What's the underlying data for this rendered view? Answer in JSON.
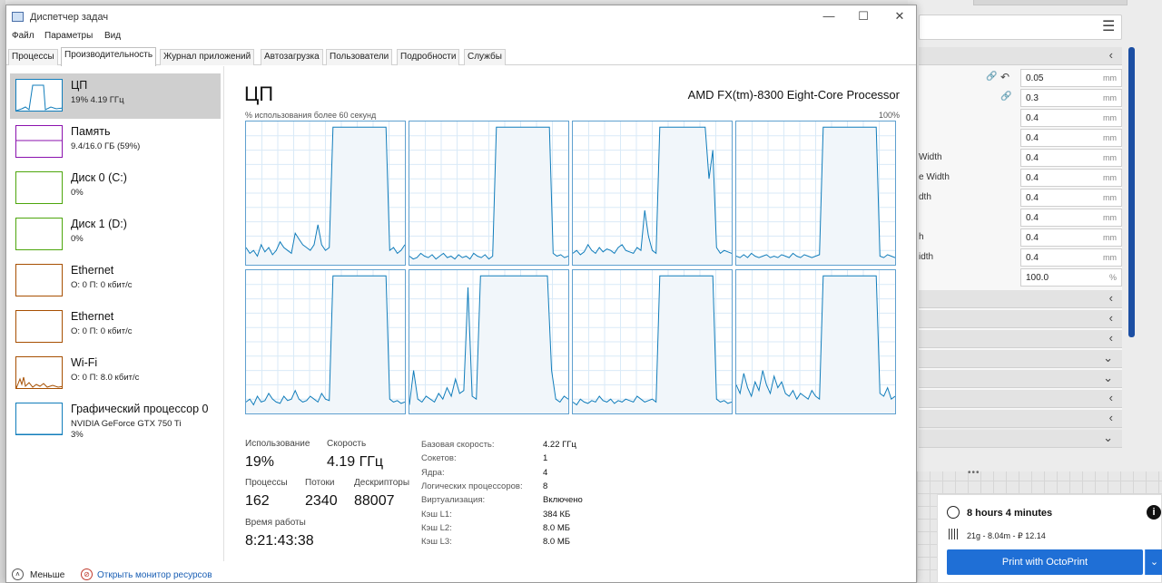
{
  "window": {
    "title": "Диспетчер задач",
    "minimize": "—",
    "maximize": "☐",
    "close": "✕"
  },
  "menu": [
    "Файл",
    "Параметры",
    "Вид"
  ],
  "tabs": [
    "Процессы",
    "Производительность",
    "Журнал приложений",
    "Автозагрузка",
    "Пользователи",
    "Подробности",
    "Службы"
  ],
  "active_tab": "Производительность",
  "resources": [
    {
      "name": "ЦП",
      "sub": "19% 4.19 ГГц",
      "color": "#117dbb"
    },
    {
      "name": "Память",
      "sub": "9.4/16.0 ГБ (59%)",
      "color": "#8b12ae"
    },
    {
      "name": "Диск 0 (C:)",
      "sub": "0%",
      "color": "#4da60c"
    },
    {
      "name": "Диск 1 (D:)",
      "sub": "0%",
      "color": "#4da60c"
    },
    {
      "name": "Ethernet",
      "sub": "О: 0 П: 0 кбит/с",
      "color": "#a74f01"
    },
    {
      "name": "Ethernet",
      "sub": "О: 0 П: 0 кбит/с",
      "color": "#a74f01"
    },
    {
      "name": "Wi-Fi",
      "sub": "О: 0 П: 8.0 кбит/с",
      "color": "#a74f01"
    },
    {
      "name": "Графический процессор 0",
      "sub": "NVIDIA GeForce GTX 750 Ti",
      "sub2": "3%",
      "color": "#117dbb"
    }
  ],
  "cpu": {
    "title": "ЦП",
    "model": "AMD FX(tm)-8300 Eight-Core Processor",
    "usage_label": "% использования более 60 секунд",
    "max_pct": "100%",
    "cores": [
      [
        12,
        8,
        10,
        6,
        14,
        9,
        12,
        7,
        10,
        16,
        12,
        10,
        8,
        22,
        18,
        14,
        12,
        10,
        14,
        28,
        14,
        10,
        12,
        96,
        96,
        96,
        96,
        96,
        96,
        96,
        96,
        96,
        96,
        96,
        96,
        96,
        96,
        96,
        10,
        12,
        8,
        10,
        14
      ],
      [
        6,
        4,
        5,
        8,
        6,
        5,
        7,
        4,
        6,
        8,
        5,
        6,
        4,
        7,
        5,
        6,
        4,
        8,
        6,
        5,
        7,
        4,
        6,
        96,
        96,
        96,
        96,
        96,
        96,
        96,
        96,
        96,
        96,
        96,
        96,
        96,
        96,
        96,
        8,
        6,
        7,
        5,
        6
      ],
      [
        8,
        10,
        7,
        9,
        14,
        10,
        8,
        12,
        9,
        11,
        10,
        8,
        12,
        14,
        10,
        9,
        8,
        12,
        10,
        38,
        20,
        10,
        8,
        96,
        96,
        96,
        96,
        96,
        96,
        96,
        96,
        96,
        96,
        96,
        96,
        96,
        60,
        80,
        12,
        8,
        10,
        9,
        8
      ],
      [
        6,
        5,
        7,
        5,
        8,
        6,
        5,
        6,
        7,
        5,
        6,
        5,
        7,
        6,
        5,
        8,
        6,
        5,
        7,
        6,
        5,
        6,
        7,
        96,
        96,
        96,
        96,
        96,
        96,
        96,
        96,
        96,
        96,
        96,
        96,
        96,
        96,
        96,
        6,
        5,
        7,
        6,
        5
      ],
      [
        8,
        10,
        6,
        12,
        8,
        9,
        14,
        10,
        8,
        7,
        12,
        9,
        10,
        16,
        10,
        8,
        9,
        12,
        10,
        8,
        14,
        10,
        9,
        96,
        96,
        96,
        96,
        96,
        96,
        96,
        96,
        96,
        96,
        96,
        96,
        96,
        96,
        96,
        10,
        8,
        9,
        7,
        8
      ],
      [
        6,
        30,
        10,
        8,
        12,
        10,
        8,
        14,
        10,
        18,
        12,
        24,
        14,
        16,
        88,
        12,
        10,
        96,
        96,
        96,
        96,
        96,
        96,
        96,
        96,
        96,
        96,
        96,
        96,
        96,
        96,
        96,
        96,
        96,
        30,
        10,
        8,
        12,
        10
      ],
      [
        8,
        6,
        10,
        8,
        7,
        9,
        8,
        12,
        9,
        8,
        10,
        7,
        9,
        8,
        10,
        9,
        8,
        12,
        10,
        8,
        9,
        10,
        8,
        96,
        96,
        96,
        96,
        96,
        96,
        96,
        96,
        96,
        96,
        96,
        96,
        96,
        96,
        96,
        10,
        8,
        9,
        7,
        8
      ],
      [
        20,
        14,
        28,
        18,
        12,
        22,
        16,
        30,
        20,
        14,
        26,
        18,
        22,
        14,
        12,
        16,
        10,
        14,
        12,
        10,
        16,
        12,
        10,
        96,
        96,
        96,
        96,
        96,
        96,
        96,
        96,
        96,
        96,
        96,
        96,
        96,
        96,
        96,
        14,
        12,
        18,
        10,
        12
      ]
    ]
  },
  "stats": {
    "usage_label": "Использование",
    "usage": "19%",
    "speed_label": "Скорость",
    "speed": "4.19 ГГц",
    "processes_label": "Процессы",
    "processes": "162",
    "threads_label": "Потоки",
    "threads": "2340",
    "handles_label": "Дескрипторы",
    "handles": "88007",
    "uptime_label": "Время работы",
    "uptime": "8:21:43:38"
  },
  "info": [
    {
      "label": "Базовая скорость:",
      "value": "4.22 ГГц"
    },
    {
      "label": "Сокетов:",
      "value": "1"
    },
    {
      "label": "Ядра:",
      "value": "4"
    },
    {
      "label": "Логических процессоров:",
      "value": "8"
    },
    {
      "label": "Виртуализация:",
      "value": "Включено"
    },
    {
      "label": "Кэш L1:",
      "value": "384 КБ"
    },
    {
      "label": "Кэш L2:",
      "value": "8.0 МБ"
    },
    {
      "label": "Кэш L3:",
      "value": "8.0 МБ"
    }
  ],
  "footer": {
    "less": "Меньше",
    "monitor": "Открыть монитор ресурсов"
  },
  "bg_app": {
    "rows": [
      {
        "label": "",
        "value": "0.05",
        "unit": "mm"
      },
      {
        "label": "",
        "value": "0.3",
        "unit": "mm"
      },
      {
        "label": "",
        "value": "0.4",
        "unit": "mm"
      },
      {
        "label": "",
        "value": "0.4",
        "unit": "mm"
      },
      {
        "label": "Width",
        "value": "0.4",
        "unit": "mm"
      },
      {
        "label": "e Width",
        "value": "0.4",
        "unit": "mm"
      },
      {
        "label": "dth",
        "value": "0.4",
        "unit": "mm"
      },
      {
        "label": "",
        "value": "0.4",
        "unit": "mm"
      },
      {
        "label": "h",
        "value": "0.4",
        "unit": "mm"
      },
      {
        "label": "idth",
        "value": "0.4",
        "unit": "mm"
      },
      {
        "label": "",
        "value": "100.0",
        "unit": "%"
      }
    ],
    "print_time": "8 hours 4 minutes",
    "print_spec": "21g - 8.04m - ₽ 12.14",
    "print_button": "Print with OctoPrint",
    "info_icon": "i"
  }
}
